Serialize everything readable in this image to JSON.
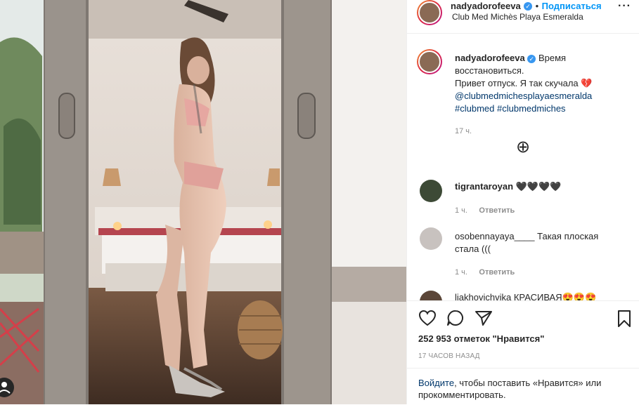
{
  "post": {
    "author": "nadyadorofeeva",
    "follow_label": "Подписаться",
    "location": "Club Med Michès Playa Esmeralda",
    "dot": "•",
    "more": "···"
  },
  "caption": {
    "author": "nadyadorofeeva",
    "text1": "Время",
    "text2": "восстановиться.",
    "text3": "Привет отпуск. Я так скучала",
    "emoji": "💔",
    "mention": "@clubmedmichesplayaesmeralda",
    "tag1": "#clubmed",
    "tag2": "#clubmedmiches",
    "time": "17 ч."
  },
  "load_more": "⊕",
  "comments": [
    {
      "user": "tigrantaroyan",
      "text": "🖤🖤🖤🖤",
      "time": "1 ч.",
      "reply": "Ответить"
    },
    {
      "user": "osobennayaya____",
      "text": "Такая плоская стала (((",
      "time": "1 ч.",
      "reply": "Ответить"
    },
    {
      "user": "liakhovichvika",
      "text": "КРАСИВАЯ😍😍😍"
    }
  ],
  "likes_text": "252 953 отметок \"Нравится\"",
  "posted_ago": "17 ЧАСОВ НАЗАД",
  "login_prompt": {
    "link": "Войдите",
    "text": ", чтобы поставить «Нравится» или прокомментировать."
  },
  "colors": {
    "accent": "#0095f6",
    "link": "#00376b",
    "muted": "#8e8e8e",
    "verified": "#3897f0"
  }
}
